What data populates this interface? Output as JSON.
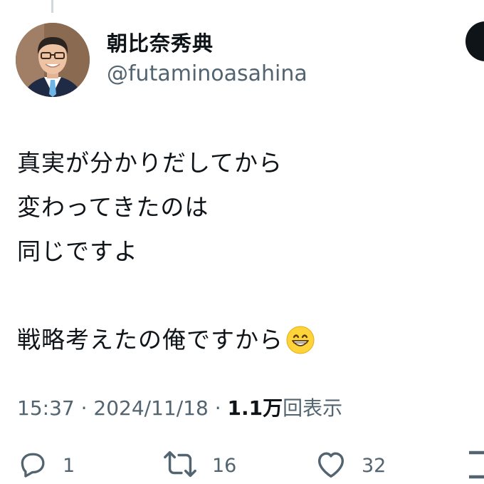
{
  "author": {
    "display_name": "朝比奈秀典",
    "handle": "@futaminoasahina"
  },
  "tweet": {
    "lines": [
      "真実が分かりだしてから",
      "変わってきたのは",
      "同じですよ",
      "",
      "戦略考えたの俺ですから"
    ],
    "emoji": "grinning-face-with-smiling-eyes"
  },
  "meta": {
    "time": "15:37",
    "separator": "·",
    "date": "2024/11/18",
    "views_count": "1.1万",
    "views_label": "回表示"
  },
  "actions": {
    "replies": "1",
    "retweets": "16",
    "likes": "32"
  },
  "icons": {
    "reply": "reply-bubble-icon",
    "retweet": "retweet-icon",
    "like": "heart-icon",
    "share": "share-icon"
  },
  "colors": {
    "text": "#0f1419",
    "secondary": "#536471",
    "thread_line": "#cfd9de"
  }
}
